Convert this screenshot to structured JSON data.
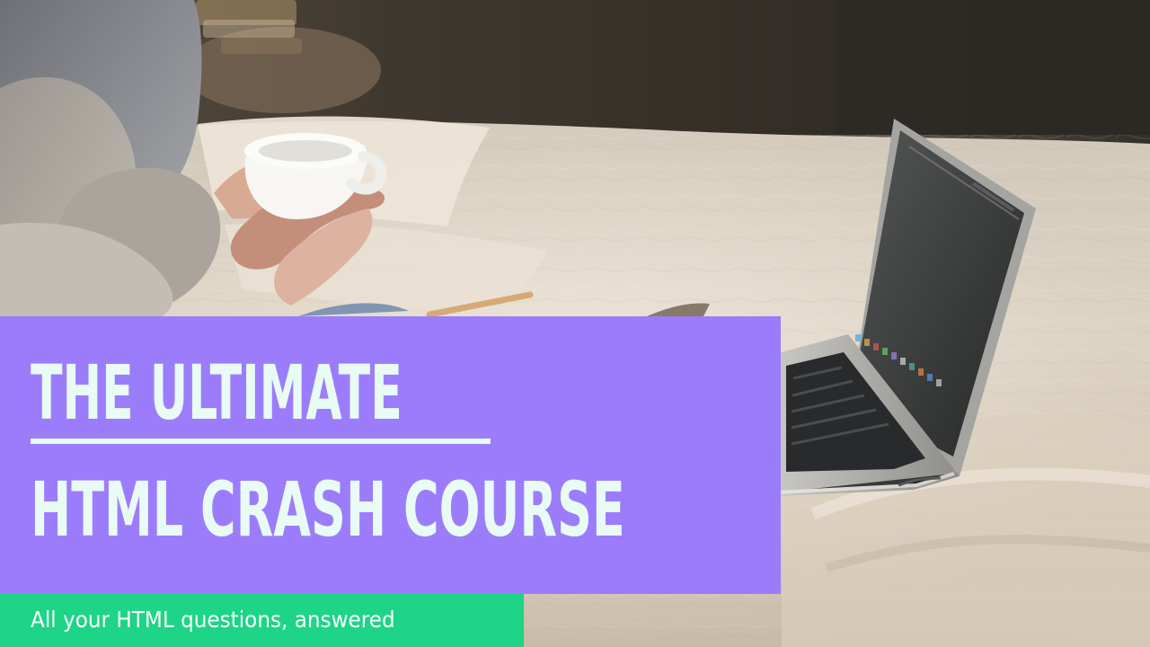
{
  "hero": {
    "title_line_1": "THE ULTIMATE",
    "title_line_2": "HTML CRASH COURSE",
    "subtitle": "All your HTML questions, answered"
  },
  "colors": {
    "title_panel": "#9b7dfc",
    "title_text": "#e9fbf5",
    "subtitle_bar": "#1ed487",
    "subtitle_text": "#f6fffb"
  },
  "image": {
    "scene": "person-holding-cup-beside-open-laptop-on-bed"
  }
}
